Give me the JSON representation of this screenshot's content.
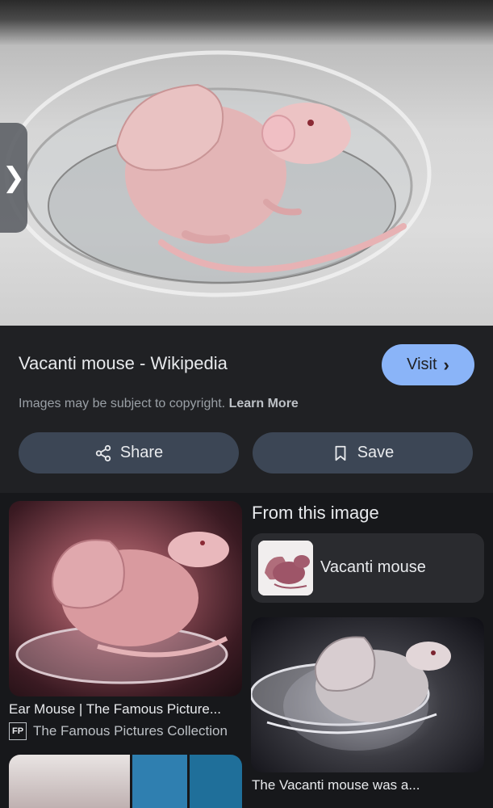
{
  "result": {
    "title": "Vacanti mouse - Wikipedia",
    "visit_label": "Visit",
    "copyright_text": "Images may be subject to copyright.",
    "learn_more": "Learn More",
    "share_label": "Share",
    "save_label": "Save"
  },
  "related": [
    {
      "caption": "Ear Mouse | The Famous Picture...",
      "source": "The Famous Pictures Collection",
      "source_icon": "FP"
    }
  ],
  "from_image": {
    "heading": "From this image",
    "entity_label": "Vacanti mouse",
    "card_caption": "The Vacanti mouse was a..."
  },
  "icons": {
    "side_tab": "chevron-right-icon",
    "visit": "chevron-right-icon",
    "share": "share-icon",
    "save": "bookmark-icon"
  },
  "colors": {
    "accent": "#8ab4f8",
    "pill": "#3c4655",
    "background": "#202124"
  }
}
